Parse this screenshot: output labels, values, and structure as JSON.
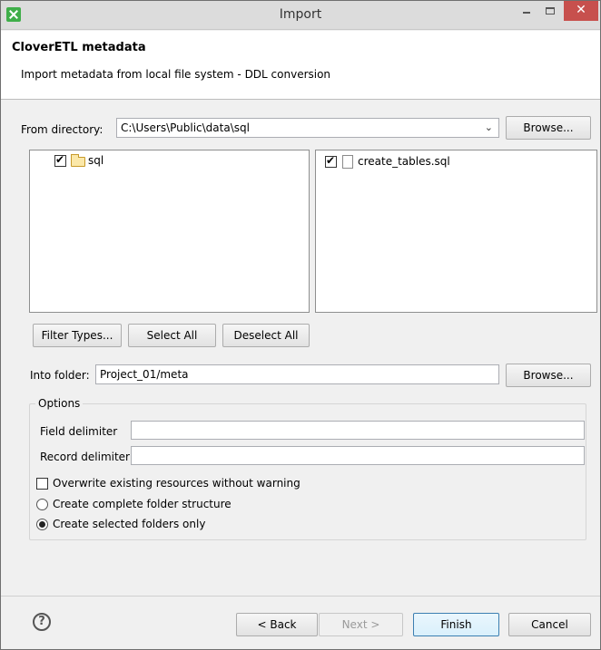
{
  "window": {
    "title": "Import"
  },
  "banner": {
    "title": "CloverETL metadata",
    "description": "Import metadata from local file system - DDL conversion"
  },
  "source": {
    "from_directory_label": "From directory:",
    "from_directory_value": "C:\\Users\\Public\\data\\sql",
    "browse_label": "Browse..."
  },
  "folder_tree": {
    "items": [
      {
        "label": "sql",
        "checked": true,
        "icon": "folder-open-icon"
      }
    ]
  },
  "file_list": {
    "items": [
      {
        "label": "create_tables.sql",
        "checked": true,
        "icon": "file-icon"
      }
    ]
  },
  "selection_buttons": {
    "filter_types": "Filter Types...",
    "select_all": "Select All",
    "deselect_all": "Deselect All"
  },
  "destination": {
    "into_folder_label": "Into folder:",
    "into_folder_value": "Project_01/meta",
    "browse_label": "Browse..."
  },
  "options": {
    "title": "Options",
    "field_delimiter_label": "Field delimiter",
    "field_delimiter_value": "",
    "record_delimiter_label": "Record delimiter",
    "record_delimiter_value": "",
    "overwrite_label": "Overwrite existing resources without warning",
    "overwrite_checked": false,
    "create_complete_label": "Create complete folder structure",
    "create_selected_label": "Create selected folders only",
    "selected_structure": "Create selected folders only"
  },
  "footer": {
    "help_glyph": "?",
    "back_label": "< Back",
    "next_label": "Next >",
    "finish_label": "Finish",
    "cancel_label": "Cancel"
  },
  "colors": {
    "close_button": "#c7504d",
    "dialog_bg": "#f0f0f0",
    "accent": "#3fae49"
  }
}
